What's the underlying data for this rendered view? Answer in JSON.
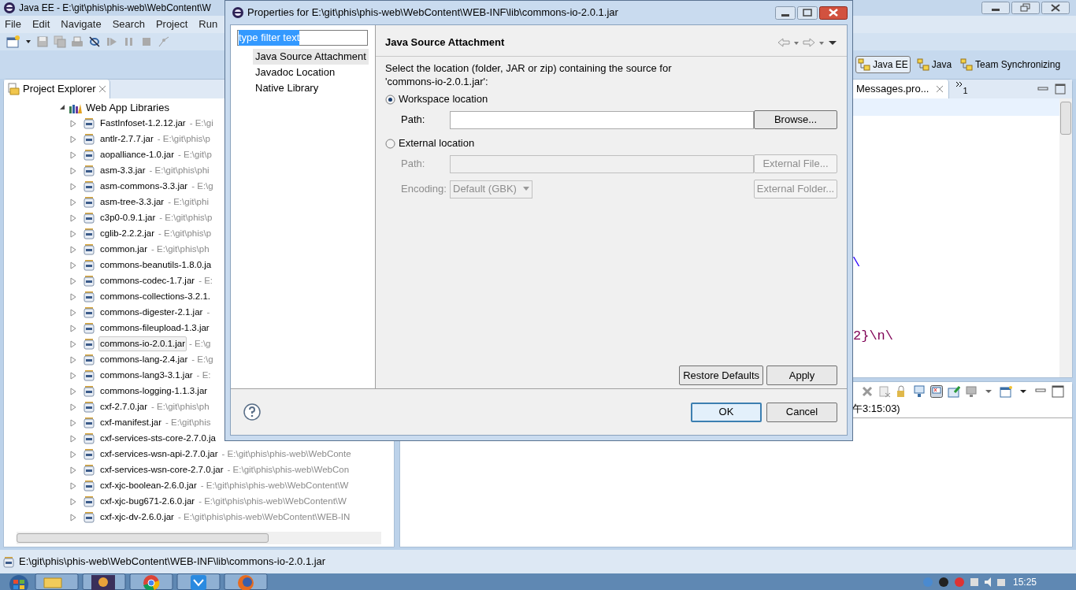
{
  "ide": {
    "title": "Java EE - E:\\git\\phis\\phis-web\\WebContent\\W",
    "menu": [
      "File",
      "Edit",
      "Navigate",
      "Search",
      "Project",
      "Run"
    ],
    "perspectives": [
      {
        "label": "Java EE",
        "selected": true
      },
      {
        "label": "Java",
        "selected": false
      },
      {
        "label": "Team Synchronizing",
        "selected": false
      }
    ],
    "explorer": {
      "tab": "Project Explorer",
      "tree": [
        {
          "label": "Web App Libraries",
          "expanded": true,
          "children": [
            {
              "name": "FastInfoset-1.2.12.jar",
              "path": "- E:\\gi",
              "expanded": false,
              "selected": false
            },
            {
              "name": "antlr-2.7.7.jar",
              "path": "- E:\\git\\phis\\p",
              "expanded": false,
              "selected": false
            },
            {
              "name": "aopalliance-1.0.jar",
              "path": "- E:\\git\\p",
              "expanded": false,
              "selected": false
            },
            {
              "name": "asm-3.3.jar",
              "path": "- E:\\git\\phis\\phi",
              "expanded": false,
              "selected": false
            },
            {
              "name": "asm-commons-3.3.jar",
              "path": "- E:\\g",
              "expanded": false,
              "selected": false
            },
            {
              "name": "asm-tree-3.3.jar",
              "path": "- E:\\git\\phi",
              "expanded": false,
              "selected": false
            },
            {
              "name": "c3p0-0.9.1.jar",
              "path": "- E:\\git\\phis\\p",
              "expanded": false,
              "selected": false
            },
            {
              "name": "cglib-2.2.2.jar",
              "path": "- E:\\git\\phis\\p",
              "expanded": false,
              "selected": false
            },
            {
              "name": "common.jar",
              "path": "- E:\\git\\phis\\ph",
              "expanded": false,
              "selected": false
            },
            {
              "name": "commons-beanutils-1.8.0.ja",
              "expanded": false,
              "selected": false
            },
            {
              "name": "commons-codec-1.7.jar",
              "path": "- E:",
              "expanded": false,
              "selected": false
            },
            {
              "name": "commons-collections-3.2.1.",
              "expanded": false,
              "selected": false
            },
            {
              "name": "commons-digester-2.1.jar",
              "path": "-",
              "expanded": false,
              "selected": false
            },
            {
              "name": "commons-fileupload-1.3.jar",
              "expanded": false,
              "selected": false
            },
            {
              "name": "commons-io-2.0.1.jar",
              "path": "- E:\\g",
              "expanded": false,
              "selected": true
            },
            {
              "name": "commons-lang-2.4.jar",
              "path": "- E:\\g",
              "expanded": false,
              "selected": false
            },
            {
              "name": "commons-lang3-3.1.jar",
              "path": "- E:",
              "expanded": false,
              "selected": false
            },
            {
              "name": "commons-logging-1.1.3.jar",
              "expanded": false,
              "selected": false
            },
            {
              "name": "cxf-2.7.0.jar",
              "path": "- E:\\git\\phis\\ph",
              "expanded": false,
              "selected": false
            },
            {
              "name": "cxf-manifest.jar",
              "path": "- E:\\git\\phis",
              "expanded": false,
              "selected": false
            },
            {
              "name": "cxf-services-sts-core-2.7.0.ja",
              "expanded": false,
              "selected": false
            },
            {
              "name": "cxf-services-wsn-api-2.7.0.jar",
              "path": "- E:\\git\\phis\\phis-web\\WebConte",
              "expanded": false,
              "selected": false
            },
            {
              "name": "cxf-services-wsn-core-2.7.0.jar",
              "path": "- E:\\git\\phis\\phis-web\\WebCon",
              "expanded": false,
              "selected": false
            },
            {
              "name": "cxf-xjc-boolean-2.6.0.jar",
              "path": "- E:\\git\\phis\\phis-web\\WebContent\\W",
              "expanded": false,
              "selected": false
            },
            {
              "name": "cxf-xjc-bug671-2.6.0.jar",
              "path": "- E:\\git\\phis\\phis-web\\WebContent\\W",
              "expanded": false,
              "selected": false
            },
            {
              "name": "cxf-xjc-dv-2.6.0.jar",
              "path": "- E:\\git\\phis\\phis-web\\WebContent\\WEB-IN",
              "expanded": false,
              "selected": false
            }
          ]
        }
      ]
    },
    "editor": {
      "tabs": [
        {
          "label": "Messages.pro...",
          "selected": true
        }
      ],
      "overflow_count": "1",
      "code": [
        "\\",
        "2}\\n\\"
      ]
    },
    "console": {
      "text": "午3:15:03)"
    },
    "status_bar": "E:\\git\\phis\\phis-web\\WebContent\\WEB-INF\\lib\\commons-io-2.0.1.jar"
  },
  "dialog": {
    "title": "Properties for E:\\git\\phis\\phis-web\\WebContent\\WEB-INF\\lib\\commons-io-2.0.1.jar",
    "filter": {
      "value": "type filter text"
    },
    "pages": [
      {
        "label": "Java Source Attachment",
        "selected": true
      },
      {
        "label": "Javadoc Location",
        "selected": false
      },
      {
        "label": "Native Library",
        "selected": false
      }
    ],
    "heading": "Java Source Attachment",
    "description": "Select the location (folder, JAR or zip) containing the source for 'commons-io-2.0.1.jar':",
    "options": [
      {
        "label": "Workspace location",
        "selected": true,
        "fields": [
          {
            "kind": "text",
            "label": "Path:",
            "disabled": false,
            "button": "Browse..."
          }
        ]
      },
      {
        "label": "External location",
        "selected": false,
        "fields": [
          {
            "kind": "text",
            "label": "Path:",
            "disabled": true,
            "button": "External File..."
          },
          {
            "kind": "select",
            "label": "Encoding:",
            "value": "Default (GBK)",
            "disabled": true,
            "button": "External Folder..."
          }
        ]
      }
    ],
    "page_buttons": [
      "Restore Defaults",
      "Apply"
    ],
    "buttons": [
      {
        "label": "OK",
        "default": true
      },
      {
        "label": "Cancel",
        "default": false
      }
    ]
  },
  "taskbar": {
    "clock": "15:25"
  }
}
